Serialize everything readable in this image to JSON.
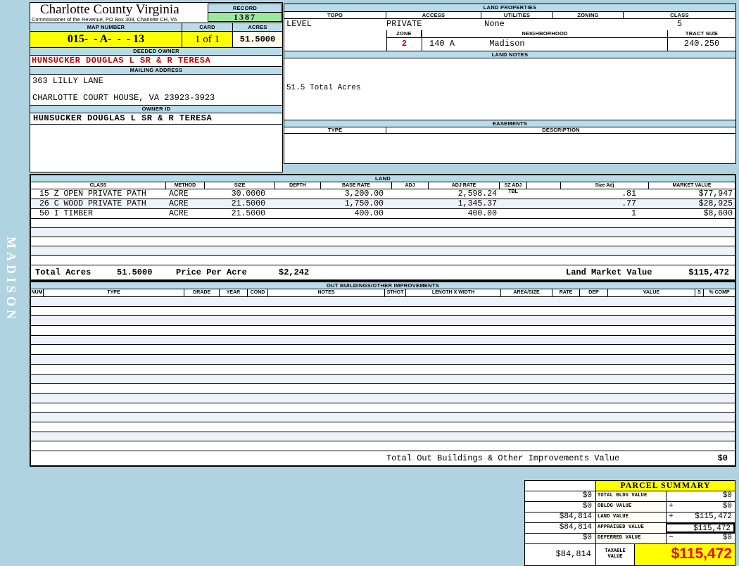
{
  "sidebar": {
    "watermark": "MADISON"
  },
  "header": {
    "title": "Charlotte County Virginia",
    "subtitle": "Commissioner of the Revenue, PO Box 308, Charlotte CH, VA",
    "record_label": "RECORD",
    "record_value": "1387",
    "map_number_label": "MAP NUMBER",
    "map_number_value": "015-  - A-  -  - 13",
    "card_label": "CARD",
    "card_value": "1 of 1",
    "acres_label": "ACRES",
    "acres_value": "51.5000"
  },
  "owner": {
    "deeded_owner_label": "DEEDED OWNER",
    "deeded_owner": "HUNSUCKER DOUGLAS L SR & R TERESA",
    "mailing_address_label": "MAILING ADDRESS",
    "address_line1": "363 LILLY LANE",
    "address_line2": "CHARLOTTE COURT HOUSE, VA 23923-3923",
    "owner_id_label": "OWNER ID",
    "owner_id": "HUNSUCKER DOUGLAS L SR & R TERESA"
  },
  "land_properties": {
    "section_label": "LAND PROPERTIES",
    "topo_label": "TOPO",
    "topo_value": "LEVEL",
    "access_label": "ACCESS",
    "access_value": "PRIVATE",
    "utilities_label": "UTILITIES",
    "utilities_value": "None",
    "zoning_label": "ZONING",
    "zoning_value": "",
    "class_label": "CLASS",
    "class_value": "5",
    "zone_label": "ZONE",
    "zone_value": "2",
    "neighborhood_label": "NEIGHBORHOOD",
    "neighborhood_code": "140 A",
    "neighborhood_name": "Madison",
    "tract_size_label": "TRACT SIZE",
    "tract_size_value": "240.250"
  },
  "land_notes": {
    "section_label": "LAND NOTES",
    "note": "51.5 Total Acres"
  },
  "easements": {
    "section_label": "EASEMENTS",
    "type_label": "TYPE",
    "description_label": "DESCRIPTION"
  },
  "land_table": {
    "section_label": "LAND",
    "headers": {
      "class": "CLASS",
      "method": "METHOD",
      "size": "SIZE",
      "depth": "DEPTH",
      "base_rate": "BASE RATE",
      "adj": "ADJ",
      "adj_rate": "ADJ RATE",
      "sz_adj_tbl": "SZ ADJ TBL",
      "blank": "",
      "size_adj": "Size Adj",
      "market_value": "MARKET VALUE"
    },
    "rows": [
      {
        "class": "15 Z OPEN PRIVATE PATH",
        "method": "ACRE",
        "size": "30.0000",
        "depth": "",
        "base_rate": "3,200.00",
        "adj": "",
        "adj_rate": "2,598.24",
        "sz_adj_tbl": "",
        "blank": "",
        "size_adj": ".81",
        "market_value": "$77,947"
      },
      {
        "class": "26 C WOOD PRIVATE PATH",
        "method": "ACRE",
        "size": "21.5000",
        "depth": "",
        "base_rate": "1,750.00",
        "adj": "",
        "adj_rate": "1,345.37",
        "sz_adj_tbl": "",
        "blank": "",
        "size_adj": ".77",
        "market_value": "$28,925"
      },
      {
        "class": "50 I TIMBER",
        "method": "ACRE",
        "size": "21.5000",
        "depth": "",
        "base_rate": "400.00",
        "adj": "",
        "adj_rate": "400.00",
        "sz_adj_tbl": "",
        "blank": "",
        "size_adj": "1",
        "market_value": "$8,600"
      }
    ],
    "totals": {
      "total_acres_label": "Total Acres",
      "total_acres": "51.5000",
      "price_per_acre_label": "Price Per Acre",
      "price_per_acre": "$2,242",
      "land_market_value_label": "Land Market Value",
      "land_market_value": "$115,472"
    }
  },
  "out_buildings": {
    "section_label": "OUT BUILDINGS/OTHER IMPROVEMENTS",
    "headers": {
      "num": "NUM",
      "type": "TYPE",
      "grade": "GRADE",
      "year": "YEAR",
      "cond": "COND",
      "notes": "NOTES",
      "sthgt": "STHGT",
      "length_x_width": "LENGTH X WIDTH",
      "area_size": "AREA/SIZE",
      "rate": "RATE",
      "dep": "DEP",
      "value": "VALUE",
      "s": "S",
      "pct_comp": "% COMP"
    },
    "total_label": "Total Out Buildings & Other Improvements Value",
    "total_value": "$0"
  },
  "parcel_summary": {
    "title": "PARCEL SUMMARY",
    "rows": [
      {
        "prior": "$0",
        "label": "TOTAL BLDG VALUE",
        "sign": "",
        "value": "$0"
      },
      {
        "prior": "$0",
        "label": "OBLDG VALUE",
        "sign": "+",
        "value": "$0"
      },
      {
        "prior": "$84,814",
        "label": "LAND VALUE",
        "sign": "+",
        "value": "$115,472"
      },
      {
        "prior": "$84,814",
        "label": "APPRAISED VALUE",
        "sign": "",
        "value": "$115,472"
      },
      {
        "prior": "$0",
        "label": "DEFERRED VALUE",
        "sign": "−",
        "value": "$0"
      }
    ],
    "taxable": {
      "prior": "$84,814",
      "label_line1": "TAXABLE",
      "label_line2": "VALUE",
      "value": "$115,472"
    }
  }
}
